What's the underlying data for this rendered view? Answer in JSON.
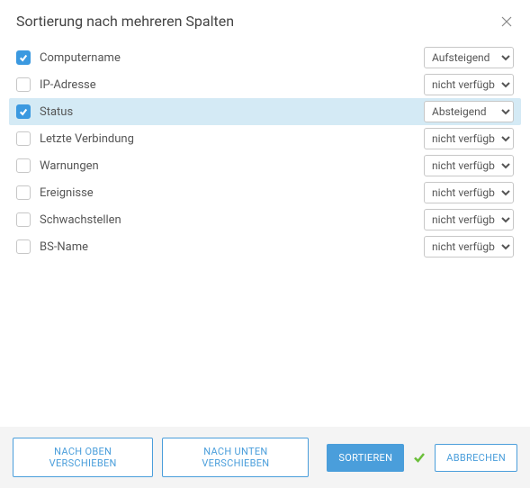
{
  "dialog": {
    "title": "Sortierung nach mehreren Spalten"
  },
  "rows": [
    {
      "checked": true,
      "label": "Computername",
      "sort": "Aufsteigend"
    },
    {
      "checked": false,
      "label": "IP-Adresse",
      "sort": "nicht verfügbar"
    },
    {
      "checked": true,
      "label": "Status",
      "sort": "Absteigend",
      "selected": true
    },
    {
      "checked": false,
      "label": "Letzte Verbindung",
      "sort": "nicht verfügbar"
    },
    {
      "checked": false,
      "label": "Warnungen",
      "sort": "nicht verfügbar"
    },
    {
      "checked": false,
      "label": "Ereignisse",
      "sort": "nicht verfügbar"
    },
    {
      "checked": false,
      "label": "Schwachstellen",
      "sort": "nicht verfügbar"
    },
    {
      "checked": false,
      "label": "BS-Name",
      "sort": "nicht verfügbar"
    }
  ],
  "sortOptions": [
    "Aufsteigend",
    "Absteigend",
    "nicht verfügbar"
  ],
  "buttons": {
    "moveUp": "NACH OBEN VERSCHIEBEN",
    "moveDown": "NACH UNTEN VERSCHIEBEN",
    "sort": "SORTIEREN",
    "cancel": "ABBRECHEN"
  }
}
